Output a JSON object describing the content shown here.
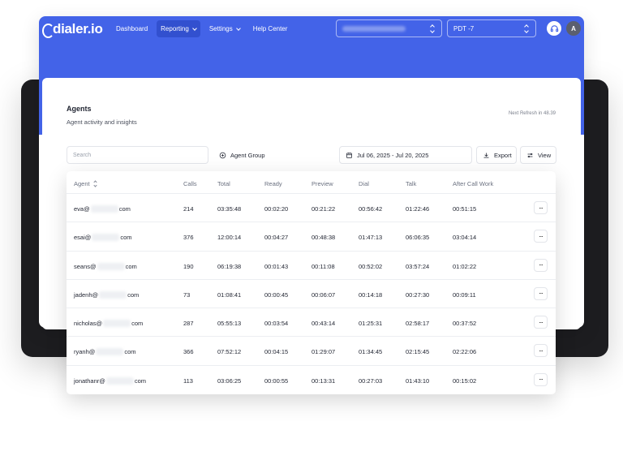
{
  "app": {
    "logo_text": "dialer.io"
  },
  "nav": {
    "dashboard": "Dashboard",
    "reporting": "Reporting",
    "settings": "Settings",
    "help": "Help Center"
  },
  "header": {
    "timezone": "PDT -7",
    "avatar_initial": "A"
  },
  "page": {
    "title": "Agents",
    "subtitle": "Agent activity and insights",
    "refresh": "Next Refresh in 48.39"
  },
  "toolbar": {
    "search_placeholder": "Search",
    "agent_group": "Agent Group",
    "date_range": "Jul 06, 2025 - Jul 20, 2025",
    "export": "Export",
    "view": "View"
  },
  "table": {
    "columns": [
      "Agent",
      "Calls",
      "Total",
      "Ready",
      "Preview",
      "Dial",
      "Talk",
      "After Call Work"
    ],
    "rows": [
      {
        "agent_prefix": "eva@",
        "agent_suffix": "com",
        "calls": "214",
        "total": "03:35:48",
        "ready": "00:02:20",
        "preview": "00:21:22",
        "dial": "00:56:42",
        "talk": "01:22:46",
        "acw": "00:51:15"
      },
      {
        "agent_prefix": "esai@",
        "agent_suffix": "com",
        "calls": "376",
        "total": "12:00:14",
        "ready": "00:04:27",
        "preview": "00:48:38",
        "dial": "01:47:13",
        "talk": "06:06:35",
        "acw": "03:04:14"
      },
      {
        "agent_prefix": "seans@",
        "agent_suffix": "com",
        "calls": "190",
        "total": "06:19:38",
        "ready": "00:01:43",
        "preview": "00:11:08",
        "dial": "00:52:02",
        "talk": "03:57:24",
        "acw": "01:02:22"
      },
      {
        "agent_prefix": "jadenh@",
        "agent_suffix": "com",
        "calls": "73",
        "total": "01:08:41",
        "ready": "00:00:45",
        "preview": "00:06:07",
        "dial": "00:14:18",
        "talk": "00:27:30",
        "acw": "00:09:11"
      },
      {
        "agent_prefix": "nicholas@",
        "agent_suffix": "com",
        "calls": "287",
        "total": "05:55:13",
        "ready": "00:03:54",
        "preview": "00:43:14",
        "dial": "01:25:31",
        "talk": "02:58:17",
        "acw": "00:37:52"
      },
      {
        "agent_prefix": "ryanh@",
        "agent_suffix": "com",
        "calls": "366",
        "total": "07:52:12",
        "ready": "00:04:15",
        "preview": "01:29:07",
        "dial": "01:34:45",
        "talk": "02:15:45",
        "acw": "02:22:06"
      },
      {
        "agent_prefix": "jonathanr@",
        "agent_suffix": "com",
        "calls": "113",
        "total": "03:06:25",
        "ready": "00:00:55",
        "preview": "00:13:31",
        "dial": "00:27:03",
        "talk": "01:43:10",
        "acw": "00:15:02"
      }
    ],
    "row_action": "..."
  },
  "colors": {
    "brand": "#4363e8",
    "brand_active": "#3250cf",
    "device_frame": "#1d1d20"
  },
  "icons": [
    "headset-icon",
    "plus-circle-icon",
    "calendar-icon",
    "download-icon",
    "sliders-icon",
    "sort-icon",
    "more-icon",
    "chevron-down-icon",
    "updown-icon"
  ]
}
